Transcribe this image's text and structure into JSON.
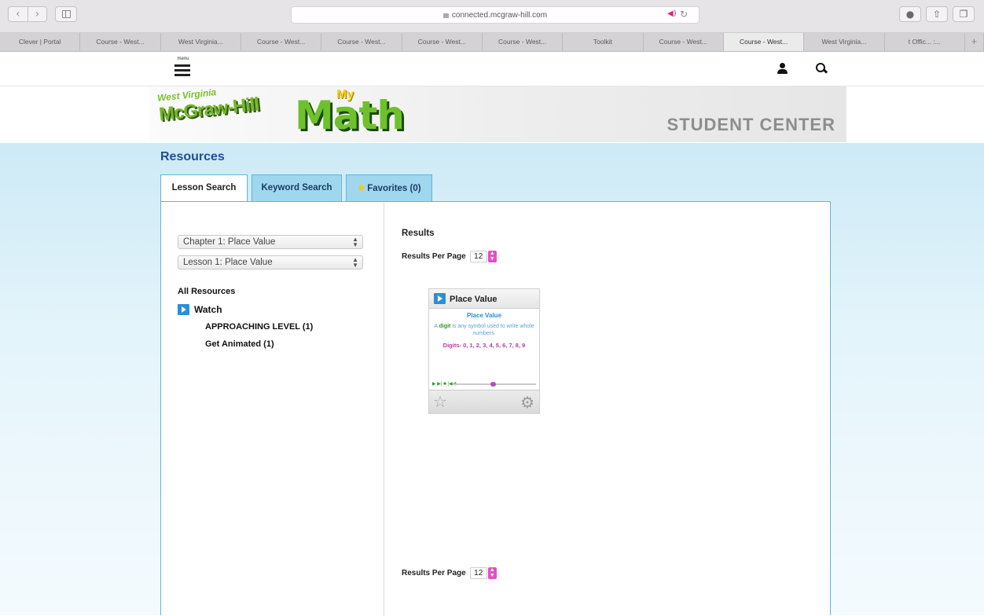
{
  "browser": {
    "url": "connected.mcgraw-hill.com",
    "nav_back": "‹",
    "nav_forward": "›",
    "tabs": [
      "Clever | Portal",
      "Course - West...",
      "West Virginia...",
      "Course - West...",
      "Course - West...",
      "Course - West...",
      "Course - West...",
      "Toolkit",
      "Course - West...",
      "Course - West...",
      "West Virginia...",
      "t Offic... :..."
    ],
    "active_tab": 9,
    "new_tab_label": "+"
  },
  "header": {
    "menu_label": "menu"
  },
  "banner": {
    "state": "West Virginia",
    "brand": "McGraw-Hill",
    "my": "My",
    "math": "Math",
    "right_title": "STUDENT CENTER"
  },
  "resources": {
    "title": "Resources",
    "tabs": {
      "lesson_search": "Lesson Search",
      "keyword_search": "Keyword Search",
      "favorites": "Favorites (0)"
    },
    "chapter_select": "Chapter 1: Place Value",
    "lesson_select": "Lesson 1: Place Value",
    "all_resources": "All Resources",
    "watch": "Watch",
    "sub_items": [
      "APPROACHING LEVEL (1)",
      "Get Animated (1)"
    ],
    "results_heading": "Results",
    "results_per_page_label": "Results Per Page",
    "results_per_page_value": "12"
  },
  "card": {
    "title": "Place Value",
    "thumb_title": "Place Value",
    "thumb_desc_prefix": "A",
    "thumb_desc_word": "digit",
    "thumb_desc_rest": "is any symbol used to write whole numbers.",
    "thumb_digits": "Digits- 0, 1, 2, 3, 4, 5, 6, 7, 8, 9",
    "player_controls": "▶ ▶| ■ |◀◀"
  },
  "colors": {
    "link_blue": "#1d4f93",
    "tab_blue": "#9fd7ef",
    "accent_pink": "#e34fc6"
  },
  "icons": [
    "user-icon",
    "search-icon",
    "menu-icon",
    "play-icon",
    "star-icon",
    "gear-icon"
  ]
}
